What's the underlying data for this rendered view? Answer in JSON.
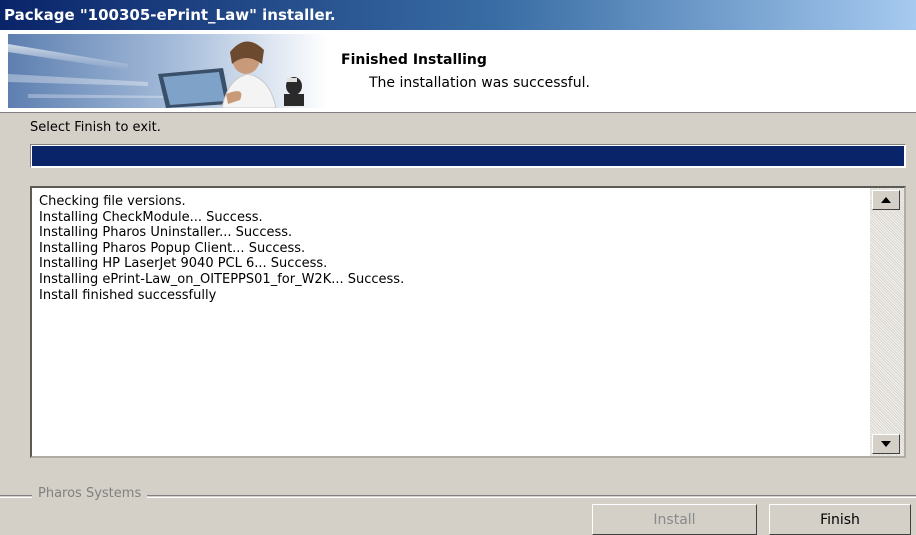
{
  "window": {
    "title": "Package \"100305-ePrint_Law\" installer."
  },
  "banner": {
    "heading": "Finished Installing",
    "subheading": "The installation was successful."
  },
  "instruction": "Select Finish to exit.",
  "progress": {
    "fraction": 1.0,
    "color": "#0a246a"
  },
  "log": {
    "lines": [
      "Checking file versions.",
      "Installing CheckModule... Success.",
      "Installing Pharos Uninstaller... Success.",
      "Installing Pharos Popup Client... Success.",
      "Installing HP LaserJet 9040 PCL 6... Success.",
      "Installing ePrint-Law_on_OITEPPS01_for_W2K... Success.",
      "Install finished successfully"
    ]
  },
  "footer": {
    "group_label": "Pharos Systems",
    "install_label": "Install",
    "finish_label": "Finish"
  },
  "icons": {
    "scroll_up": "scroll-up-arrow-icon",
    "scroll_down": "scroll-down-arrow-icon",
    "banner": "installer-banner-illustration"
  }
}
